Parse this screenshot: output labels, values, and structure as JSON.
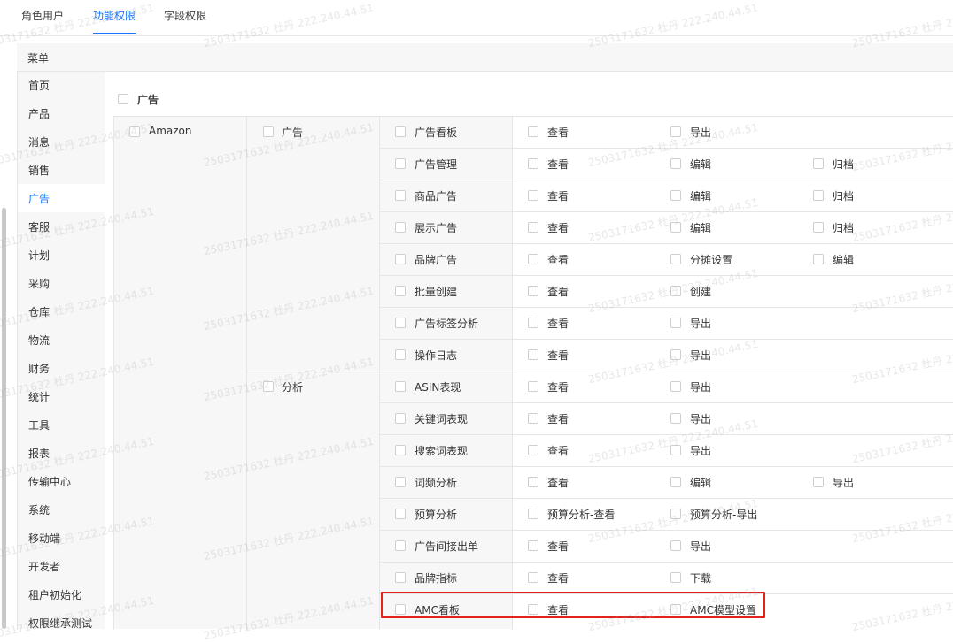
{
  "tabs": [
    {
      "label": "角色用户"
    },
    {
      "label": "功能权限"
    },
    {
      "label": "字段权限"
    }
  ],
  "panel_header": "菜单",
  "sidebar_items": [
    "首页",
    "产品",
    "消息",
    "销售",
    "广告",
    "客服",
    "计划",
    "采购",
    "仓库",
    "物流",
    "财务",
    "统计",
    "工具",
    "报表",
    "传输中心",
    "系统",
    "移动端",
    "开发者",
    "租户初始化",
    "权限继承测试"
  ],
  "active_menu_index": 4,
  "section_title": "广告",
  "platform": "Amazon",
  "groups": [
    {
      "label": "广告",
      "rows": [
        {
          "name": "广告看板",
          "perms": [
            "查看",
            "导出"
          ]
        },
        {
          "name": "广告管理",
          "perms": [
            "查看",
            "编辑",
            "归档"
          ]
        },
        {
          "name": "商品广告",
          "perms": [
            "查看",
            "编辑",
            "归档"
          ]
        },
        {
          "name": "展示广告",
          "perms": [
            "查看",
            "编辑",
            "归档"
          ]
        },
        {
          "name": "品牌广告",
          "perms": [
            "查看",
            "分摊设置",
            "编辑"
          ]
        },
        {
          "name": "批量创建",
          "perms": [
            "查看",
            "创建"
          ]
        },
        {
          "name": "广告标签分析",
          "perms": [
            "查看",
            "导出"
          ]
        },
        {
          "name": "操作日志",
          "perms": [
            "查看",
            "导出"
          ]
        }
      ]
    },
    {
      "label": "分析",
      "rows": [
        {
          "name": "ASIN表现",
          "perms": [
            "查看",
            "导出"
          ]
        },
        {
          "name": "关键词表现",
          "perms": [
            "查看",
            "导出"
          ]
        },
        {
          "name": "搜索词表现",
          "perms": [
            "查看",
            "导出"
          ]
        },
        {
          "name": "词频分析",
          "perms": [
            "查看",
            "编辑",
            "导出"
          ]
        },
        {
          "name": "预算分析",
          "perms": [
            "预算分析-查看",
            "预算分析-导出"
          ]
        },
        {
          "name": "广告间接出单",
          "perms": [
            "查看",
            "导出"
          ]
        },
        {
          "name": "品牌指标",
          "perms": [
            "查看",
            "下载"
          ]
        },
        {
          "name": "AMC看板",
          "perms": [
            "查看",
            "AMC模型设置"
          ]
        }
      ]
    }
  ],
  "watermark": "2503171632 杜丹 222.240.44.51"
}
